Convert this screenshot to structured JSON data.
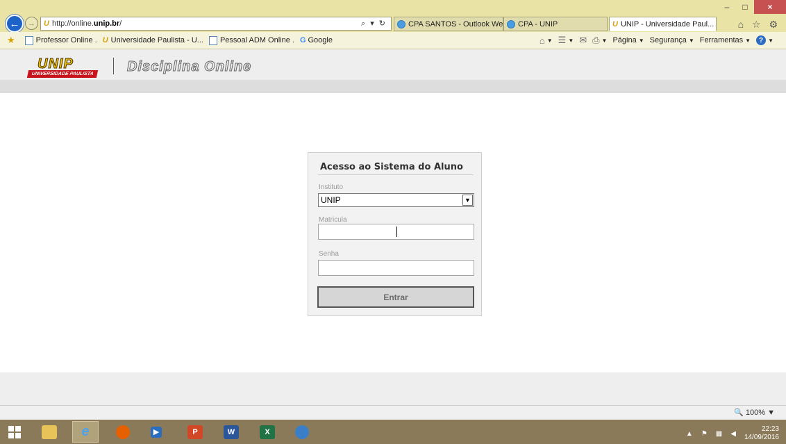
{
  "browser": {
    "url_prefix": "http://online.",
    "url_domain": "unip.br",
    "url_suffix": "/",
    "address_tools": "⌕ ▾ ↻",
    "tabs": [
      {
        "label": "CPA SANTOS - Outlook We...",
        "active": false
      },
      {
        "label": "CPA - UNIP",
        "active": false
      },
      {
        "label": "UNIP - Universidade Paul...",
        "active": true
      }
    ],
    "tab_close": "×",
    "window_controls": {
      "minimize": "–",
      "maximize": "□",
      "close": "×"
    },
    "top_icons": "⌂ ☆ ⚙"
  },
  "favorites": {
    "items": [
      {
        "label": "Professor Online ."
      },
      {
        "label": "Universidade Paulista - U..."
      },
      {
        "label": "Pessoal ADM Online ."
      },
      {
        "label": "Google"
      }
    ],
    "commands": {
      "pagina": "Página",
      "seguranca": "Segurança",
      "ferramentas": "Ferramentas"
    }
  },
  "header": {
    "logo_text": "UNIP",
    "logo_band": "UNIVERSIDADE PAULISTA",
    "title": "Disciplina Online"
  },
  "login": {
    "title": "Acesso ao Sistema do Aluno",
    "instituto_label": "Instituto",
    "instituto_value": "UNIP",
    "matricula_label": "Matricula",
    "matricula_value": "",
    "senha_label": "Senha",
    "senha_value": "",
    "submit_label": "Entrar"
  },
  "status": {
    "zoom": "100%"
  },
  "taskbar": {
    "time": "22:23",
    "date": "14/09/2016"
  }
}
